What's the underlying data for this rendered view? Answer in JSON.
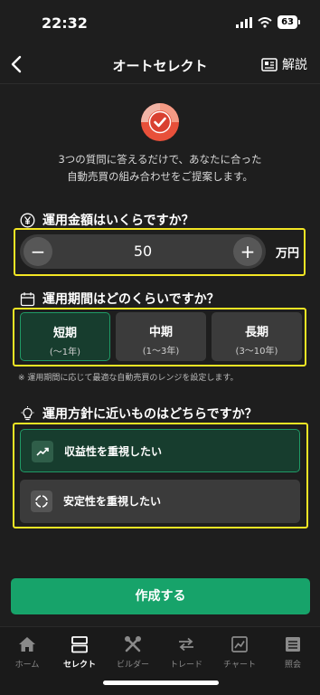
{
  "status_bar": {
    "time": "22:32",
    "battery": "63"
  },
  "nav": {
    "title": "オートセレクト",
    "help_label": "解説"
  },
  "intro": {
    "line1": "3つの質問に答えるだけで、あなたに合った",
    "line2": "自動売買の組み合わせをご提案します。"
  },
  "question1": {
    "title": "運用金額はいくらですか？",
    "icon": "yen-circle-icon",
    "value": "50",
    "minus": "−",
    "plus": "+",
    "unit": "万円"
  },
  "question2": {
    "title": "運用期間はどのくらいですか？",
    "icon": "calendar-icon",
    "options": [
      {
        "label": "短期",
        "sub": "(〜1年)",
        "selected": true
      },
      {
        "label": "中期",
        "sub": "(1〜3年)",
        "selected": false
      },
      {
        "label": "長期",
        "sub": "(3〜10年)",
        "selected": false
      }
    ],
    "note": "※ 運用期間に応じて最適な自動売買のレンジを設定します。"
  },
  "question3": {
    "title": "運用方針に近いものはどちらですか？",
    "icon": "lightbulb-icon",
    "options": [
      {
        "label": "収益性を重視したい",
        "icon": "trend-up-icon",
        "selected": true
      },
      {
        "label": "安定性を重視したい",
        "icon": "stability-circle-icon",
        "selected": false
      }
    ]
  },
  "cta": {
    "label": "作成する"
  },
  "tabs": [
    {
      "label": "ホーム",
      "icon": "home-icon",
      "active": false
    },
    {
      "label": "セレクト",
      "icon": "select-icon",
      "active": true
    },
    {
      "label": "ビルダー",
      "icon": "builder-tools-icon",
      "active": false
    },
    {
      "label": "トレード",
      "icon": "trade-arrows-icon",
      "active": false
    },
    {
      "label": "チャート",
      "icon": "chart-icon",
      "active": false
    },
    {
      "label": "照会",
      "icon": "inquiry-list-icon",
      "active": false
    }
  ],
  "colors": {
    "background": "#1e1e1e",
    "accent_green": "#17a36a",
    "selected_bg": "#173d2e",
    "highlight_yellow": "#f3e524",
    "logo_orange": "#e8503a"
  }
}
